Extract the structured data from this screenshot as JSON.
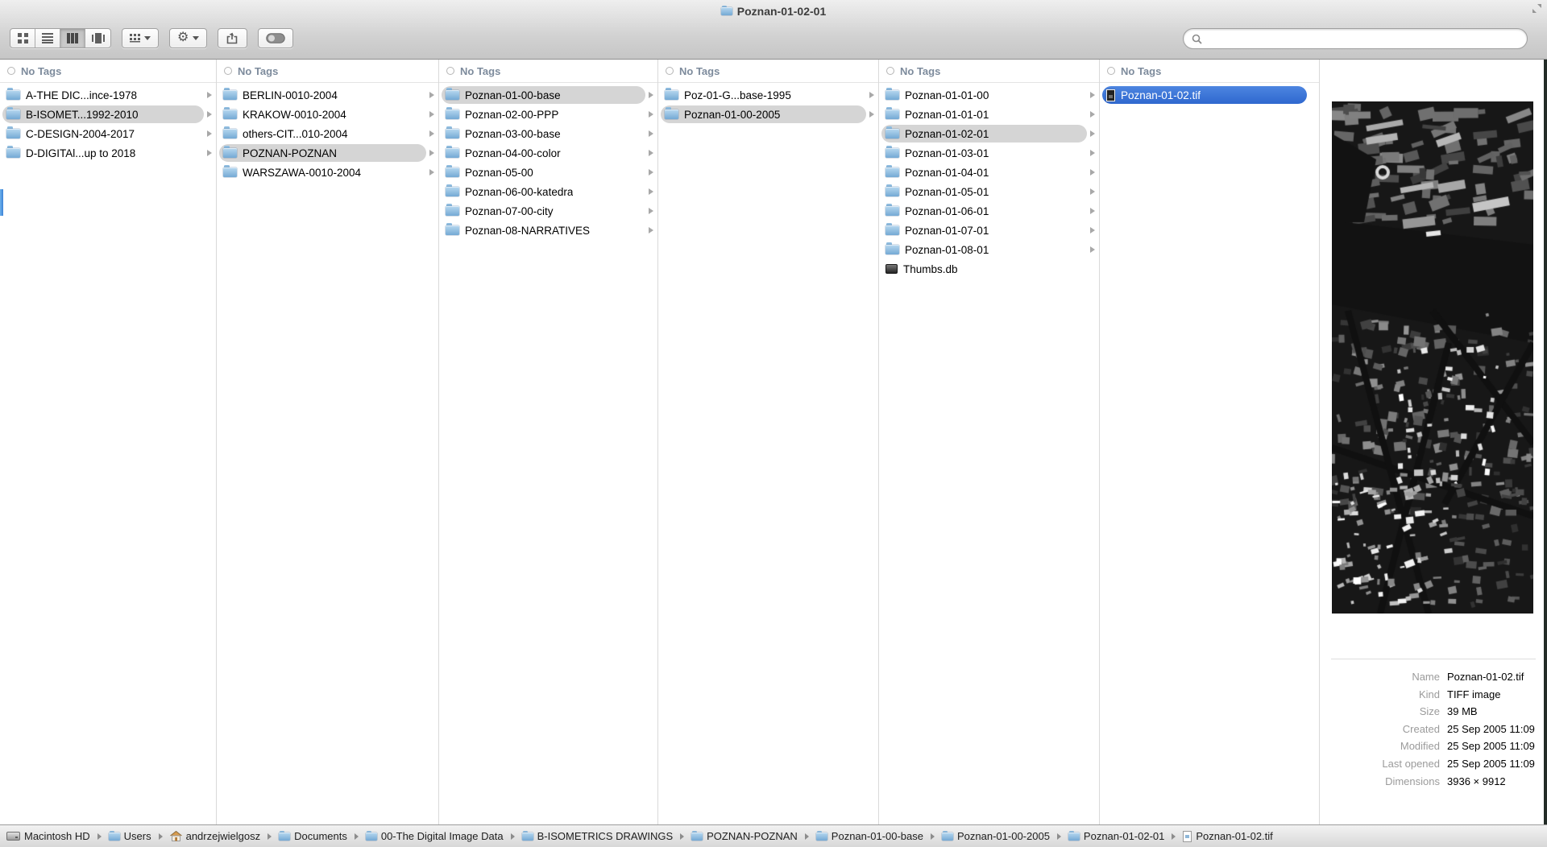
{
  "window": {
    "title": "Poznan-01-02-01"
  },
  "toolbar": {
    "view_segments": [
      {
        "name": "icon-view",
        "selected": false
      },
      {
        "name": "list-view",
        "selected": false
      },
      {
        "name": "column-view",
        "selected": true
      },
      {
        "name": "coverflow-view",
        "selected": false
      }
    ],
    "buttons": [
      "arrange",
      "action",
      "share",
      "edit-tags"
    ],
    "search": {
      "placeholder": "",
      "value": ""
    }
  },
  "columns": [
    {
      "header": "No Tags",
      "items": [
        {
          "label": "A-THE DIC...ince-1978",
          "icon": "folder",
          "arrow": true,
          "selected": ""
        },
        {
          "label": "B-ISOMET...1992-2010",
          "icon": "folder",
          "arrow": true,
          "selected": "gray"
        },
        {
          "label": "C-DESIGN-2004-2017",
          "icon": "folder",
          "arrow": true,
          "selected": ""
        },
        {
          "label": "D-DIGITAl...up to 2018",
          "icon": "folder",
          "arrow": true,
          "selected": ""
        }
      ]
    },
    {
      "header": "No Tags",
      "items": [
        {
          "label": "BERLIN-0010-2004",
          "icon": "folder",
          "arrow": true,
          "selected": ""
        },
        {
          "label": "KRAKOW-0010-2004",
          "icon": "folder",
          "arrow": true,
          "selected": ""
        },
        {
          "label": "others-CIT...010-2004",
          "icon": "folder",
          "arrow": true,
          "selected": ""
        },
        {
          "label": "POZNAN-POZNAN",
          "icon": "folder",
          "arrow": true,
          "selected": "gray"
        },
        {
          "label": "WARSZAWA-0010-2004",
          "icon": "folder",
          "arrow": true,
          "selected": ""
        }
      ]
    },
    {
      "header": "No Tags",
      "items": [
        {
          "label": "Poznan-01-00-base",
          "icon": "folder",
          "arrow": true,
          "selected": "gray"
        },
        {
          "label": "Poznan-02-00-PPP",
          "icon": "folder",
          "arrow": true,
          "selected": ""
        },
        {
          "label": "Poznan-03-00-base",
          "icon": "folder",
          "arrow": true,
          "selected": ""
        },
        {
          "label": "Poznan-04-00-color",
          "icon": "folder",
          "arrow": true,
          "selected": ""
        },
        {
          "label": "Poznan-05-00",
          "icon": "folder",
          "arrow": true,
          "selected": ""
        },
        {
          "label": "Poznan-06-00-katedra",
          "icon": "folder",
          "arrow": true,
          "selected": ""
        },
        {
          "label": "Poznan-07-00-city",
          "icon": "folder",
          "arrow": true,
          "selected": ""
        },
        {
          "label": "Poznan-08-NARRATIVES",
          "icon": "folder",
          "arrow": true,
          "selected": ""
        }
      ]
    },
    {
      "header": "No Tags",
      "items": [
        {
          "label": "Poz-01-G...base-1995",
          "icon": "folder",
          "arrow": true,
          "selected": ""
        },
        {
          "label": "Poznan-01-00-2005",
          "icon": "folder",
          "arrow": true,
          "selected": "gray"
        }
      ]
    },
    {
      "header": "No Tags",
      "items": [
        {
          "label": "Poznan-01-01-00",
          "icon": "folder",
          "arrow": true,
          "selected": ""
        },
        {
          "label": "Poznan-01-01-01",
          "icon": "folder",
          "arrow": true,
          "selected": ""
        },
        {
          "label": "Poznan-01-02-01",
          "icon": "folder",
          "arrow": true,
          "selected": "gray"
        },
        {
          "label": "Poznan-01-03-01",
          "icon": "folder",
          "arrow": true,
          "selected": ""
        },
        {
          "label": "Poznan-01-04-01",
          "icon": "folder",
          "arrow": true,
          "selected": ""
        },
        {
          "label": "Poznan-01-05-01",
          "icon": "folder",
          "arrow": true,
          "selected": ""
        },
        {
          "label": "Poznan-01-06-01",
          "icon": "folder",
          "arrow": true,
          "selected": ""
        },
        {
          "label": "Poznan-01-07-01",
          "icon": "folder",
          "arrow": true,
          "selected": ""
        },
        {
          "label": "Poznan-01-08-01",
          "icon": "folder",
          "arrow": true,
          "selected": ""
        },
        {
          "label": "Thumbs.db",
          "icon": "db",
          "arrow": false,
          "selected": ""
        }
      ]
    },
    {
      "header": "No Tags",
      "items": [
        {
          "label": "Poznan-01-02.tif",
          "icon": "tif",
          "arrow": false,
          "selected": "blue"
        }
      ]
    }
  ],
  "preview": {
    "image_name": "aerial-map-of-poznan-dark-tiff-preview",
    "metadata": [
      {
        "label": "Name",
        "value": "Poznan-01-02.tif"
      },
      {
        "label": "Kind",
        "value": "TIFF image"
      },
      {
        "label": "Size",
        "value": "39 MB"
      },
      {
        "label": "Created",
        "value": "25 Sep 2005 11:09"
      },
      {
        "label": "Modified",
        "value": "25 Sep 2005 11:09"
      },
      {
        "label": "Last opened",
        "value": "25 Sep 2005 11:09"
      },
      {
        "label": "Dimensions",
        "value": "3936 × 9912"
      }
    ]
  },
  "pathbar": {
    "items": [
      {
        "label": "Macintosh HD",
        "icon": "drive"
      },
      {
        "label": "Users",
        "icon": "folder"
      },
      {
        "label": "andrzejwielgosz",
        "icon": "home"
      },
      {
        "label": "Documents",
        "icon": "folder"
      },
      {
        "label": "00-The Digital Image Data",
        "icon": "folder"
      },
      {
        "label": "B-ISOMETRICS DRAWINGS",
        "icon": "folder"
      },
      {
        "label": "POZNAN-POZNAN",
        "icon": "folder"
      },
      {
        "label": "Poznan-01-00-base",
        "icon": "folder"
      },
      {
        "label": "Poznan-01-00-2005",
        "icon": "folder"
      },
      {
        "label": "Poznan-01-02-01",
        "icon": "folder"
      },
      {
        "label": "Poznan-01-02.tif",
        "icon": "file"
      }
    ]
  },
  "colors": {
    "selection_blue": "#3b77d8",
    "selection_gray": "#d5d5d5",
    "folder_blue_top": "#b8d9f0",
    "folder_blue_bottom": "#74a9d4",
    "header_text": "#7d8b9c"
  }
}
